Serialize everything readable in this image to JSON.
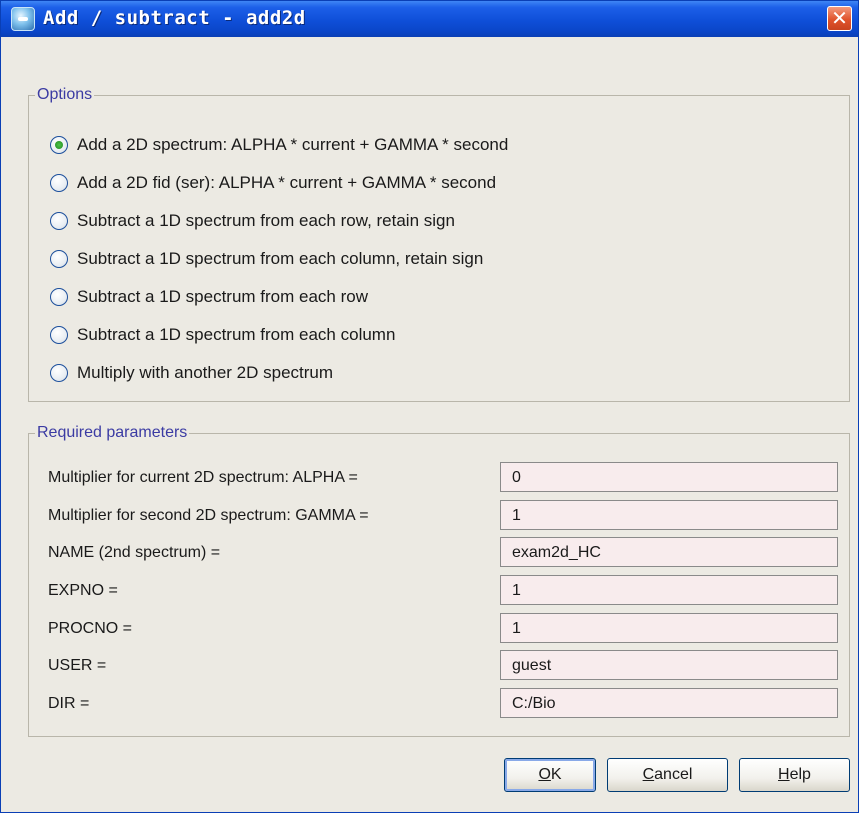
{
  "window": {
    "title": "Add / subtract - add2d",
    "close_label": "✕"
  },
  "options": {
    "legend": "Options",
    "selected_index": 0,
    "items": [
      {
        "label": "Add a 2D spectrum: ALPHA * current + GAMMA * second",
        "checked": true
      },
      {
        "label": "Add a 2D fid (ser): ALPHA * current + GAMMA * second",
        "checked": false
      },
      {
        "label": "Subtract a 1D spectrum from each row, retain sign",
        "checked": false
      },
      {
        "label": "Subtract a 1D spectrum from each column, retain sign",
        "checked": false
      },
      {
        "label": "Subtract a 1D spectrum from each row",
        "checked": false
      },
      {
        "label": "Subtract a 1D spectrum from each column",
        "checked": false
      },
      {
        "label": "Multiply with another 2D spectrum",
        "checked": false
      }
    ]
  },
  "parameters": {
    "legend": "Required parameters",
    "rows": [
      {
        "label": "Multiplier for current 2D spectrum: ALPHA =",
        "value": "0"
      },
      {
        "label": "Multiplier for second 2D spectrum: GAMMA =",
        "value": "1"
      },
      {
        "label": "NAME (2nd spectrum) =",
        "value": "exam2d_HC"
      },
      {
        "label": "EXPNO =",
        "value": "1"
      },
      {
        "label": "PROCNO =",
        "value": "1"
      },
      {
        "label": "USER =",
        "value": "guest"
      },
      {
        "label": "DIR =",
        "value": "C:/Bio"
      }
    ]
  },
  "buttons": {
    "ok_mnemonic": "O",
    "ok_rest": "K",
    "cancel_mnemonic": "C",
    "cancel_rest": "ancel",
    "help_mnemonic": "H",
    "help_rest": "elp"
  },
  "colors": {
    "titlebar": "#0f4fd8",
    "legend_text": "#3b3ba3",
    "field_bg": "#f8eced",
    "dialog_bg": "#eceae3",
    "close_button": "#e0532c",
    "radio_selected": "#1e8a1e"
  },
  "icons": {
    "app": "app-logo-icon",
    "close": "close-icon"
  }
}
